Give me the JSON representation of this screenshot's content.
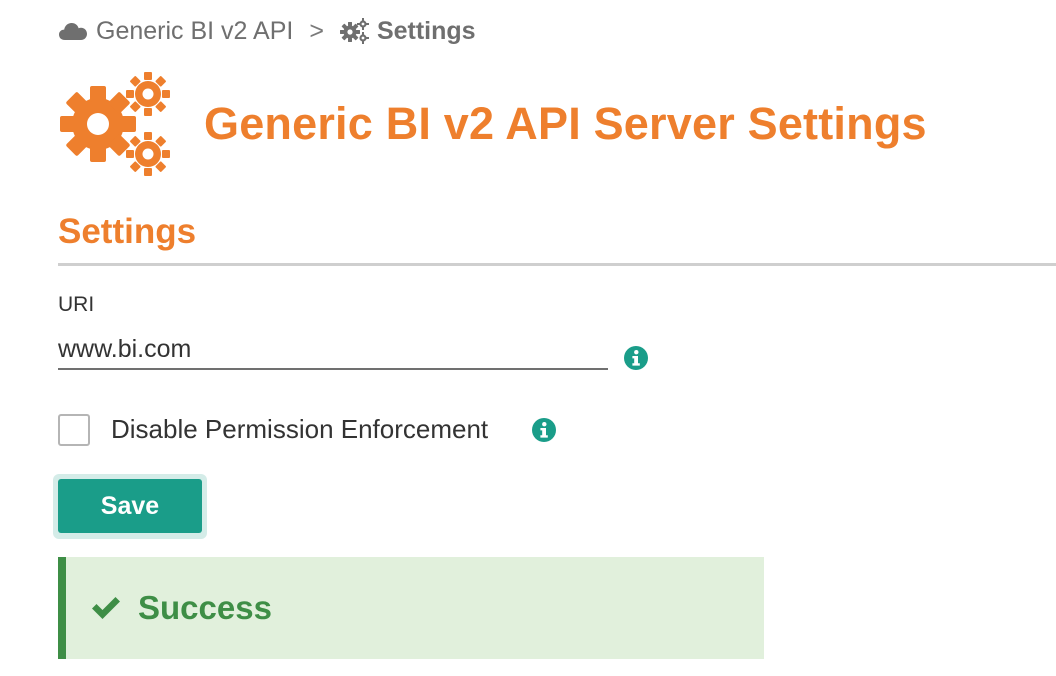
{
  "breadcrumb": {
    "parent_label": "Generic BI v2 API",
    "separator": ">",
    "current_label": "Settings",
    "parent_icon": "cloud-icon",
    "current_icon": "gears-icon"
  },
  "header": {
    "title": "Generic BI v2 API Server Settings",
    "icon": "gears-icon"
  },
  "section": {
    "title": "Settings"
  },
  "form": {
    "uri": {
      "label": "URI",
      "value": "www.bi.com",
      "info_icon": "info-icon"
    },
    "disable_permission": {
      "label": "Disable Permission Enforcement",
      "checked": false,
      "info_icon": "info-icon"
    },
    "save_label": "Save"
  },
  "alert": {
    "type": "success",
    "icon": "checkmark-icon",
    "message": "Success"
  },
  "colors": {
    "accent": "#ee7f2d",
    "primary_button": "#1a9d89",
    "info_icon": "#1a9d89",
    "success_text": "#3e8e46",
    "success_background": "#e1f0dc",
    "breadcrumb_text": "#6f6f6f"
  }
}
